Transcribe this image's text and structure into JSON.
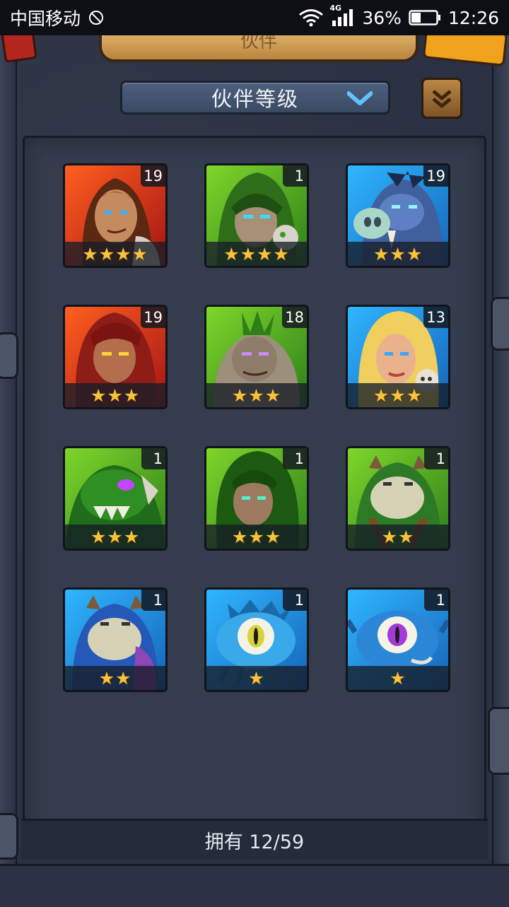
{
  "status_bar": {
    "carrier": "中国移动",
    "network": "4G",
    "battery": "36%",
    "time": "12:26"
  },
  "header": {
    "banner_text": "伙伴",
    "dropdown_label": "伙伴等级"
  },
  "colors": {
    "red": "#e4401a",
    "green": "#5cb828",
    "blue": "#2c9fea",
    "star": "#f6c33b"
  },
  "cards": [
    {
      "level": "19",
      "stars": "★★★★",
      "rarity": "red",
      "portrait": "brown-haired-hero"
    },
    {
      "level": "1",
      "stars": "★★★★",
      "rarity": "green",
      "portrait": "hooded-archer"
    },
    {
      "level": "19",
      "stars": "★★★",
      "rarity": "blue",
      "portrait": "boar-warrior"
    },
    {
      "level": "19",
      "stars": "★★★",
      "rarity": "red",
      "portrait": "red-haired-barbarian"
    },
    {
      "level": "18",
      "stars": "★★★",
      "rarity": "green",
      "portrait": "mohawk-brute"
    },
    {
      "level": "13",
      "stars": "★★★",
      "rarity": "blue",
      "portrait": "blonde-warrior"
    },
    {
      "level": "1",
      "stars": "★★★",
      "rarity": "green",
      "portrait": "tusked-beast"
    },
    {
      "level": "1",
      "stars": "★★★",
      "rarity": "green",
      "portrait": "green-haired-warrior"
    },
    {
      "level": "1",
      "stars": "★★",
      "rarity": "green",
      "portrait": "green-frog-brute"
    },
    {
      "level": "1",
      "stars": "★★",
      "rarity": "blue",
      "portrait": "blue-frog-brute"
    },
    {
      "level": "1",
      "stars": "★",
      "rarity": "blue",
      "portrait": "yellow-eye-monster"
    },
    {
      "level": "1",
      "stars": "★",
      "rarity": "blue",
      "portrait": "purple-eye-monster"
    }
  ],
  "footer": {
    "owned_label": "拥有 12/59"
  }
}
